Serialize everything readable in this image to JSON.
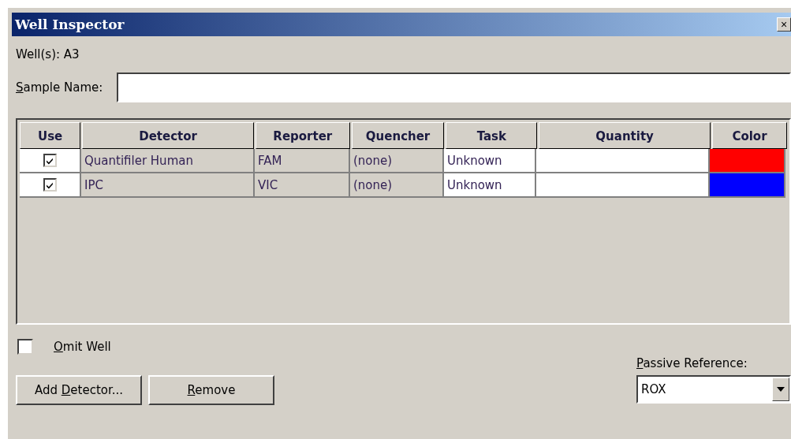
{
  "window": {
    "title": "Well Inspector",
    "close": "×"
  },
  "wells": "Well(s): A3",
  "sample_name": {
    "label": {
      "key": "S",
      "after": "ample Name:"
    }
  },
  "table": {
    "columns": [
      "Use",
      "Detector",
      "Reporter",
      "Quencher",
      "Task",
      "Quantity",
      "Color"
    ],
    "rows": [
      {
        "use": true,
        "detector": "Quantifiler Human",
        "reporter": "FAM",
        "quencher": "(none)",
        "task": "Unknown",
        "color": "#ff0000"
      },
      {
        "use": true,
        "detector": "IPC",
        "reporter": "VIC",
        "quencher": "(none)",
        "task": "Unknown",
        "color": "#0000ff"
      }
    ]
  },
  "omit_well": {
    "label": {
      "key": "O",
      "after": "mit Well"
    },
    "checked": false
  },
  "buttons": [
    {
      "label": {
        "before": "Add ",
        "key": "D",
        "after": "etector..."
      }
    },
    {
      "label": {
        "key": "R",
        "after": "emove"
      }
    }
  ],
  "passive_reference": {
    "label": {
      "key": "P",
      "after": "assive Reference:"
    },
    "value": "ROX"
  }
}
